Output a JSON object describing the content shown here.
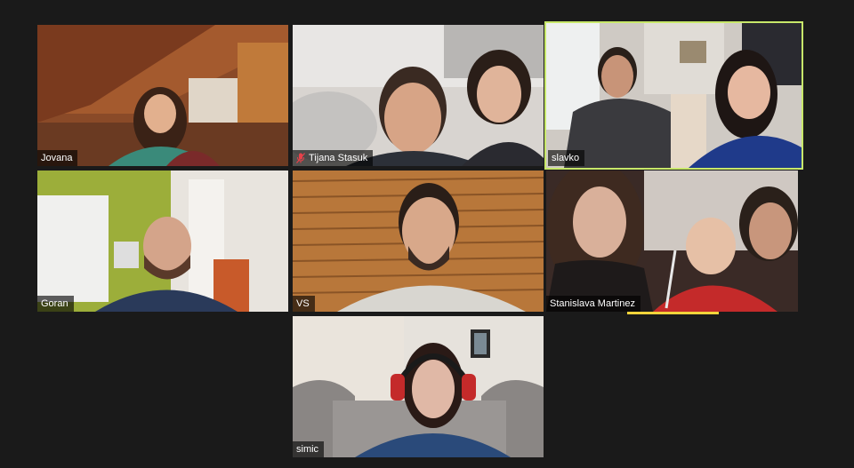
{
  "meeting": {
    "theme": {
      "background": "#1a1a1a",
      "active_speaker_border": "#c8e86a",
      "speaking_indicator": "#f2d43b",
      "muted_icon": "#e8414a"
    },
    "participants": [
      {
        "name": "Jovana",
        "muted": false,
        "active": false
      },
      {
        "name": "Tijana Stasuk",
        "muted": true,
        "active": false
      },
      {
        "name": "slavko",
        "muted": false,
        "active": true
      },
      {
        "name": "Goran",
        "muted": false,
        "active": false
      },
      {
        "name": "VS",
        "muted": false,
        "active": false
      },
      {
        "name": "Stanislava Martinez",
        "muted": false,
        "active": false,
        "speaking": true
      },
      {
        "name": "simic",
        "muted": false,
        "active": false
      }
    ]
  }
}
